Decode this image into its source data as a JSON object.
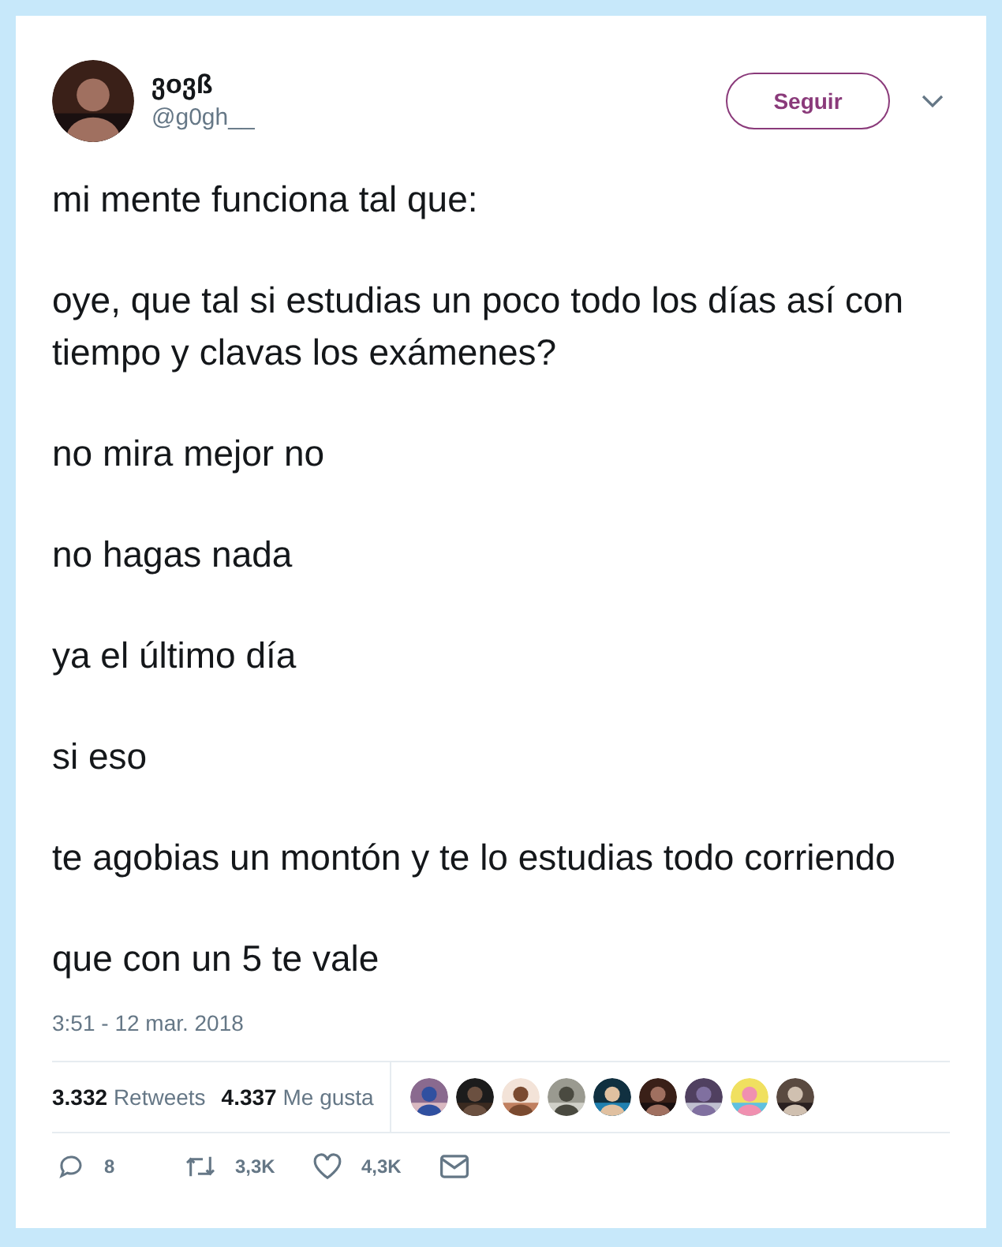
{
  "author": {
    "name": "ვoვß",
    "handle": "@g0gh__"
  },
  "follow_button": "Seguir",
  "paragraphs": [
    "mi mente funciona tal que:",
    "oye, que tal si estudias un poco todo los días así con tiempo y clavas los exámenes?",
    "no mira mejor no",
    "no hagas nada",
    "ya el último día",
    "si eso",
    "te agobias un montón y te lo estudias todo corriendo",
    "que con un 5 te vale"
  ],
  "timestamp": "3:51 - 12 mar. 2018",
  "stats": [
    {
      "count": "3.332",
      "label": "Retweets"
    },
    {
      "count": "4.337",
      "label": "Me gusta"
    }
  ],
  "likers": [
    {
      "kind": "picture"
    },
    {
      "kind": "picture"
    },
    {
      "kind": "picture"
    },
    {
      "kind": "picture"
    },
    {
      "kind": "picture"
    },
    {
      "kind": "picture"
    },
    {
      "kind": "picture"
    },
    {
      "kind": "picture"
    },
    {
      "kind": "picture"
    }
  ],
  "actions": [
    {
      "kind": "reply",
      "count": "8"
    },
    {
      "kind": "retweet",
      "count": "3,3K"
    },
    {
      "kind": "like",
      "count": "4,3K"
    },
    {
      "kind": "message"
    }
  ]
}
